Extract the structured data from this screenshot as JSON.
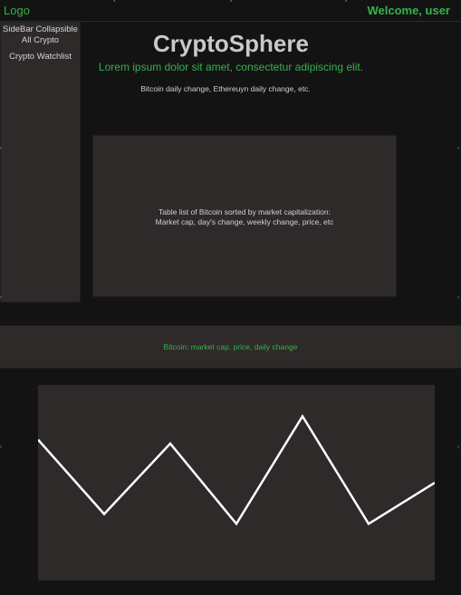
{
  "header": {
    "logo": "Logo",
    "welcome": "Welcome, user"
  },
  "sidebar": {
    "title_line1": "SideBar Collapsible",
    "items": [
      {
        "label": "All Crypto"
      },
      {
        "label": "Crypto Watchlist"
      }
    ]
  },
  "main": {
    "title": "CryptoSphere",
    "subtitle": "Lorem ipsum dolor sit amet, consectetur adipiscing elit.",
    "daily_change": "Bitcoin daily change, Ethereuyn daily change, etc.",
    "table_placeholder_line1": "Table list of Bitcoin sorted by market capitalization:",
    "table_placeholder_line2": "Market cap, day's change, weekly change, price, etc"
  },
  "bitcoin_bar": {
    "text": "Bitcoin: market cap, price, daily change"
  },
  "colors": {
    "accent": "#36b24a",
    "panel": "#2e2a2a",
    "background": "#131313"
  },
  "chart_data": {
    "type": "line",
    "x": [
      0,
      1,
      2,
      3,
      4,
      5,
      6
    ],
    "values": [
      0.72,
      0.34,
      0.7,
      0.29,
      0.84,
      0.29,
      0.5
    ],
    "ylim": [
      0,
      1
    ],
    "title": "",
    "xlabel": "",
    "ylabel": "",
    "grid": false
  }
}
